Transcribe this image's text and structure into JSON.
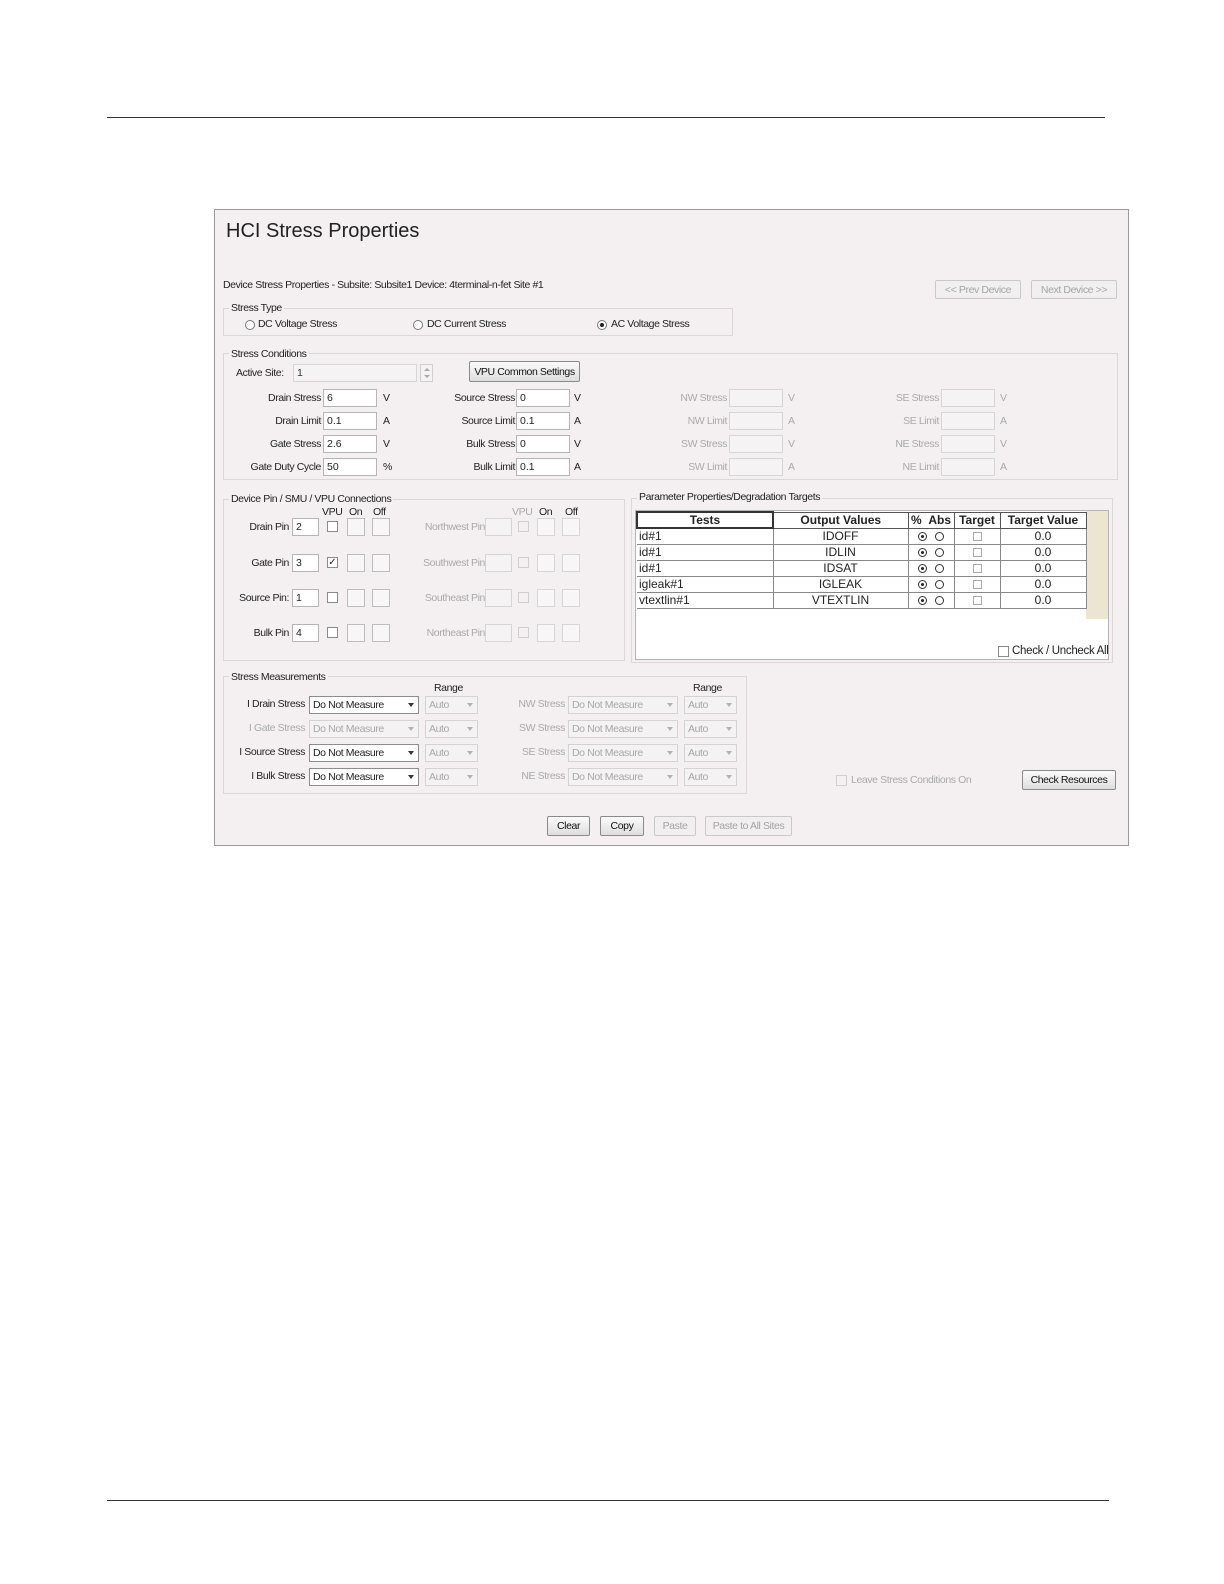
{
  "title": "HCI Stress Properties",
  "header": {
    "device_props": "Device Stress Properties -   Subsite: Subsite1   Device: 4terminal-n-fet   Site #1",
    "prev_device": "<< Prev Device",
    "next_device": "Next Device >>"
  },
  "stress_type": {
    "title": "Stress Type",
    "options": [
      "DC Voltage Stress",
      "DC Current Stress",
      "AC Voltage Stress"
    ],
    "selected": "AC Voltage Stress"
  },
  "stress_conditions": {
    "title": "Stress Conditions",
    "active_site_label": "Active Site:",
    "active_site_value": "1",
    "vpu_common_settings": "VPU Common Settings",
    "rows": [
      {
        "l1": "Drain Stress",
        "v1": "6",
        "u1": "V",
        "l2": "Source Stress",
        "v2": "0",
        "u2": "V",
        "l3": "NW Stress",
        "u3": "V",
        "l4": "SE Stress",
        "u4": "V"
      },
      {
        "l1": "Drain Limit",
        "v1": "0.1",
        "u1": "A",
        "l2": "Source Limit",
        "v2": "0.1",
        "u2": "A",
        "l3": "NW Limit",
        "u3": "A",
        "l4": "SE Limit",
        "u4": "A"
      },
      {
        "l1": "Gate Stress",
        "v1": "2.6",
        "u1": "V",
        "l2": "Bulk Stress",
        "v2": "0",
        "u2": "V",
        "l3": "SW Stress",
        "u3": "V",
        "l4": "NE Stress",
        "u4": "V"
      },
      {
        "l1": "Gate Duty Cycle",
        "v1": "50",
        "u1": "%",
        "l2": "Bulk Limit",
        "v2": "0.1",
        "u2": "A",
        "l3": "SW Limit",
        "u3": "A",
        "l4": "NE Limit",
        "u4": "A"
      }
    ]
  },
  "pins": {
    "title": "Device Pin / SMU / VPU Connections",
    "hdr_vpu": "VPU",
    "hdr_on": "On",
    "hdr_off": "Off",
    "rows": [
      {
        "label": "Drain Pin",
        "value": "2",
        "vpu_checked": false,
        "right_label": "Northwest Pin"
      },
      {
        "label": "Gate Pin",
        "value": "3",
        "vpu_checked": true,
        "right_label": "Southwest Pin"
      },
      {
        "label": "Source Pin:",
        "value": "1",
        "vpu_checked": false,
        "right_label": "Southeast Pin"
      },
      {
        "label": "Bulk Pin",
        "value": "4",
        "vpu_checked": false,
        "right_label": "Northeast Pin"
      }
    ],
    "check_mark": "✓"
  },
  "params": {
    "title": "Parameter Properties/Degradation Targets",
    "columns": [
      "Tests",
      "Output Values",
      "%",
      "Abs",
      "Target",
      "Target Value"
    ],
    "rows": [
      {
        "test": "id#1",
        "output": "IDOFF",
        "value": "0.0"
      },
      {
        "test": "id#1",
        "output": "IDLIN",
        "value": "0.0"
      },
      {
        "test": "id#1",
        "output": "IDSAT",
        "value": "0.0"
      },
      {
        "test": "igleak#1",
        "output": "IGLEAK",
        "value": "0.0"
      },
      {
        "test": "vtextlin#1",
        "output": "VTEXTLIN",
        "value": "0.0"
      }
    ],
    "check_all": "Check / Uncheck All"
  },
  "measurements": {
    "title": "Stress Measurements",
    "range_label": "Range",
    "rows": [
      {
        "label": "I Drain Stress",
        "value": "Do Not Measure",
        "range": "Auto",
        "r_label": "NW Stress",
        "r_value": "Do Not Measure",
        "r_range": "Auto",
        "enabled": true
      },
      {
        "label": "I Gate Stress",
        "value": "Do Not Measure",
        "range": "Auto",
        "r_label": "SW Stress",
        "r_value": "Do Not Measure",
        "r_range": "Auto",
        "enabled": false
      },
      {
        "label": "I Source Stress",
        "value": "Do Not Measure",
        "range": "Auto",
        "r_label": "SE Stress",
        "r_value": "Do Not Measure",
        "r_range": "Auto",
        "enabled": true
      },
      {
        "label": "I Bulk Stress",
        "value": "Do Not Measure",
        "range": "Auto",
        "r_label": "NE Stress",
        "r_value": "Do Not Measure",
        "r_range": "Auto",
        "enabled": true
      }
    ]
  },
  "leave_stress_on": "Leave Stress Conditions On",
  "check_resources": "Check Resources",
  "footer": {
    "clear": "Clear",
    "copy": "Copy",
    "paste": "Paste",
    "paste_all": "Paste to All Sites"
  }
}
